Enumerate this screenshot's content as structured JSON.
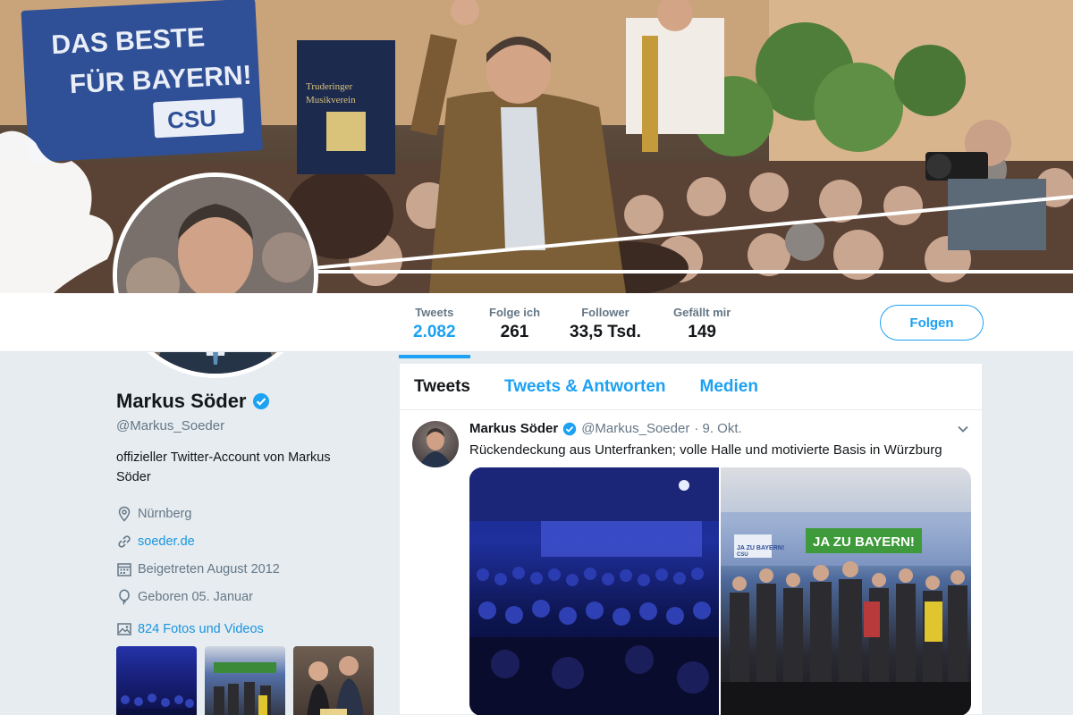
{
  "banner": {
    "sign_text": "DAS BESTE FÜR BAYERN!",
    "sign_logo": "CSU",
    "banner_text": "Truderinger Musikverein"
  },
  "stats": {
    "tweets_label": "Tweets",
    "tweets_value": "2.082",
    "following_label": "Folge ich",
    "following_value": "261",
    "followers_label": "Follower",
    "followers_value": "33,5 Tsd.",
    "likes_label": "Gefällt mir",
    "likes_value": "149"
  },
  "follow_button": "Folgen",
  "profile": {
    "name": "Markus Söder",
    "handle": "@Markus_Soeder",
    "bio": "offizieller Twitter-Account von Markus Söder",
    "location": "Nürnberg",
    "website": "soeder.de",
    "joined": "Beigetreten August 2012",
    "birthday": "Geboren 05. Januar",
    "photos_link": "824 Fotos und Videos"
  },
  "tabs": [
    "Tweets",
    "Tweets & Antworten",
    "Medien"
  ],
  "tweet": {
    "author": "Markus Söder",
    "handle": "@Markus_Soeder",
    "date": "· 9. Okt.",
    "text": "Rückendeckung aus Unterfranken; volle Halle und motivierte Basis in Würzburg",
    "media_banner": "JA ZU BAYERN!",
    "media_sign": "JA ZU BAYERN!",
    "media_sign_logo": "CSU"
  },
  "colors": {
    "accent": "#1da1f2",
    "link": "#1b95e0",
    "muted": "#657786",
    "background": "#e6ecf0"
  }
}
